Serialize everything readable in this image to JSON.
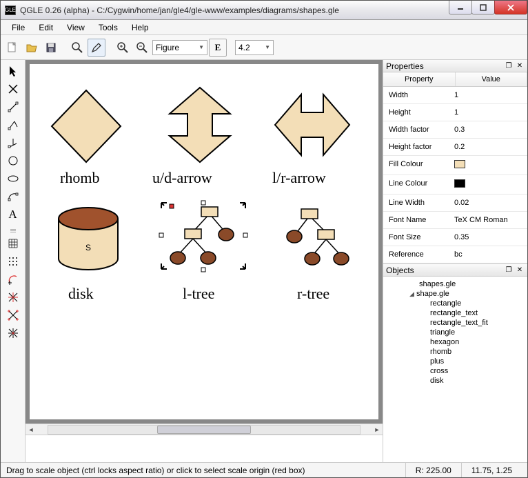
{
  "window": {
    "title": "QGLE 0.26 (alpha) - C:/Cygwin/home/jan/gle4/gle-www/examples/diagrams/shapes.gle"
  },
  "menus": [
    "File",
    "Edit",
    "View",
    "Tools",
    "Help"
  ],
  "toolbar": {
    "figure_combo": "Figure",
    "zoom_combo": "4.2"
  },
  "canvas": {
    "labels": {
      "rhomb": "rhomb",
      "ud_arrow": "u/d-arrow",
      "lr_arrow": "l/r-arrow",
      "disk": "disk",
      "disk_letter": "S",
      "ltree": "l-tree",
      "rtree": "r-tree"
    }
  },
  "colors": {
    "shape_fill": "#f3deb7",
    "tree_leaf": "#8a4a29",
    "disk_top": "#a0522d"
  },
  "properties": {
    "header_property": "Property",
    "header_value": "Value",
    "rows": [
      {
        "k": "Width",
        "v": "1"
      },
      {
        "k": "Height",
        "v": "1"
      },
      {
        "k": "Width factor",
        "v": "0.3"
      },
      {
        "k": "Height factor",
        "v": "0.2"
      },
      {
        "k": "Fill Colour",
        "swatch": "#f3deb7"
      },
      {
        "k": "Line Colour",
        "swatch": "#000000"
      },
      {
        "k": "Line Width",
        "v": "0.02"
      },
      {
        "k": "Font Name",
        "v": "TeX CM Roman"
      },
      {
        "k": "Font Size",
        "v": "0.35"
      },
      {
        "k": "Reference",
        "v": "bc"
      }
    ]
  },
  "panels": {
    "properties_title": "Properties",
    "objects_title": "Objects"
  },
  "objects": {
    "root": "shapes.gle",
    "group": "shape.gle",
    "children": [
      "rectangle",
      "rectangle_text",
      "rectangle_text_fit",
      "triangle",
      "hexagon",
      "rhomb",
      "plus",
      "cross",
      "disk"
    ]
  },
  "status": {
    "hint": "Drag to scale object (ctrl locks aspect ratio) or click to select scale origin (red box)",
    "r": "R:  225.00",
    "coords": "11.75, 1.25"
  }
}
